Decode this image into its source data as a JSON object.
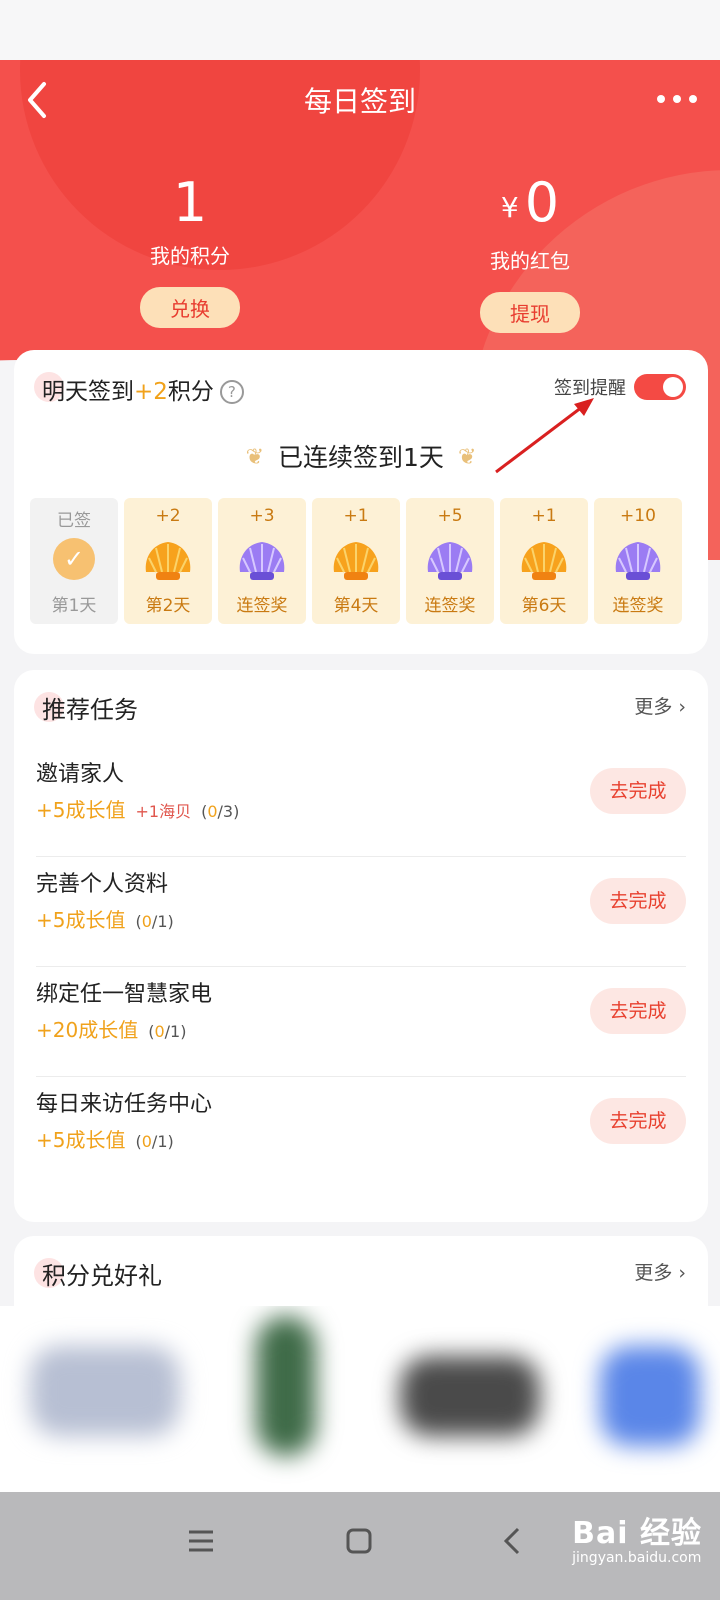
{
  "header": {
    "title": "每日签到"
  },
  "stats": {
    "points_value": "1",
    "points_label": "我的积分",
    "points_action": "兑换",
    "redpacket_currency": "¥",
    "redpacket_value": "0",
    "redpacket_label": "我的红包",
    "redpacket_action": "提现"
  },
  "sign": {
    "title_prefix": "明天签到",
    "title_bonus": "+2",
    "title_suffix": "积分",
    "help_icon": "?",
    "remind_label": "签到提醒",
    "remind_on": true,
    "streak_text": "已连续签到1天",
    "days": [
      {
        "top": "已签",
        "bottom": "第1天",
        "state": "done",
        "icon": "check-icon"
      },
      {
        "top": "+2",
        "bottom": "第2天",
        "state": "todo",
        "icon": "gold-shell-icon"
      },
      {
        "top": "+3",
        "bottom": "连签奖",
        "state": "todo",
        "icon": "purple-shell-icon"
      },
      {
        "top": "+1",
        "bottom": "第4天",
        "state": "todo",
        "icon": "gold-shell-icon"
      },
      {
        "top": "+5",
        "bottom": "连签奖",
        "state": "todo",
        "icon": "purple-shell-icon"
      },
      {
        "top": "+1",
        "bottom": "第6天",
        "state": "todo",
        "icon": "gold-shell-icon"
      },
      {
        "top": "+10",
        "bottom": "连签奖",
        "state": "todo",
        "icon": "purple-shell-icon"
      }
    ]
  },
  "tasks": {
    "title": "推荐任务",
    "more": "更多",
    "items": [
      {
        "name": "邀请家人",
        "reward": "+5成长值",
        "extra": "+1海贝",
        "done": "0",
        "total": "/3",
        "action": "去完成"
      },
      {
        "name": "完善个人资料",
        "reward": "+5成长值",
        "extra": "",
        "done": "0",
        "total": "/1",
        "action": "去完成"
      },
      {
        "name": "绑定任一智慧家电",
        "reward": "+20成长值",
        "extra": "",
        "done": "0",
        "total": "/1",
        "action": "去完成"
      },
      {
        "name": "每日来访任务中心",
        "reward": "+5成长值",
        "extra": "",
        "done": "0",
        "total": "/1",
        "action": "去完成"
      }
    ]
  },
  "gifts": {
    "title": "积分兑好礼",
    "more": "更多"
  },
  "watermark": {
    "brand": "Bai 经验",
    "site": "jingyan.baidu.com"
  },
  "colors": {
    "brand_red": "#f4504c",
    "accent_gold": "#f0a21c",
    "toggle_on": "#f44a44"
  }
}
